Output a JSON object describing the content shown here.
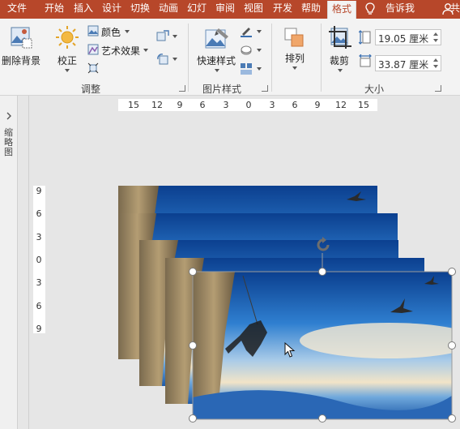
{
  "tabs": [
    {
      "label": "文件",
      "active": false
    },
    {
      "label": "开始",
      "active": false
    },
    {
      "label": "插入",
      "active": false
    },
    {
      "label": "设计",
      "active": false
    },
    {
      "label": "切换",
      "active": false
    },
    {
      "label": "动画",
      "active": false
    },
    {
      "label": "幻灯",
      "active": false
    },
    {
      "label": "审阅",
      "active": false
    },
    {
      "label": "视图",
      "active": false
    },
    {
      "label": "开发",
      "active": false
    },
    {
      "label": "帮助",
      "active": false
    },
    {
      "label": "格式",
      "active": true
    }
  ],
  "tell_me": "告诉我",
  "user_fragment": "共",
  "ribbon": {
    "remove_bg": "删除背景",
    "correct": "校正",
    "color": "颜色",
    "artistic": "艺术效果",
    "adjust_group": "调整",
    "quick_styles": "快速样式",
    "picture_styles_group": "图片样式",
    "arrange": "排列",
    "crop": "裁剪",
    "height_value": "19.05 厘米",
    "width_value": "33.87 厘米",
    "size_group": "大小"
  },
  "left_pane_label": "缩略图",
  "ruler_h": [
    "15",
    "12",
    "9",
    "6",
    "3",
    "0",
    "3",
    "6",
    "9",
    "12",
    "15"
  ],
  "ruler_v": [
    "9",
    "6",
    "3",
    "0",
    "3",
    "6",
    "9"
  ],
  "colors": {
    "accent": "#b7472a",
    "ribbon_bg": "#f3f3f3",
    "canvas_bg": "#e6e6e6"
  },
  "icons": [
    "remove-background-icon",
    "corrections-icon",
    "color-icon",
    "artistic-effects-icon",
    "compress-icon",
    "change-picture-icon",
    "reset-picture-icon",
    "quick-styles-icon",
    "border-icon",
    "effects-icon",
    "layout-icon",
    "arrange-icon",
    "crop-icon",
    "lightbulb-icon",
    "user-icon",
    "rotate-handle-icon",
    "mouse-cursor-icon"
  ]
}
